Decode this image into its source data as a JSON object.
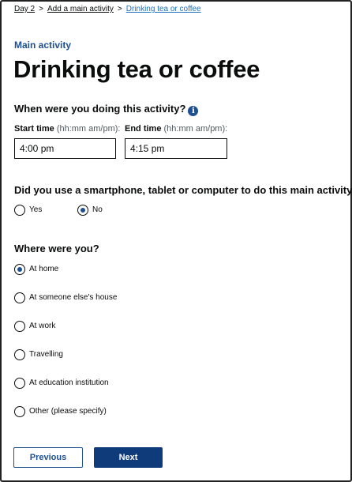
{
  "breadcrumb": {
    "items": [
      "Day 2",
      "Add a main activity",
      "Drinking tea or coffee"
    ],
    "separator": ">"
  },
  "caption": "Main activity",
  "title": "Drinking tea or coffee",
  "time_question": "When were you doing this activity?",
  "start_time": {
    "label": "Start time",
    "hint": "(hh:mm am/pm):",
    "value": "4:00 pm"
  },
  "end_time": {
    "label": "End time",
    "hint": "(hh:mm am/pm):",
    "value": "4:15 pm"
  },
  "device_question": "Did you use a smartphone, tablet or computer to do this main activity?",
  "device_options": [
    {
      "label": "Yes",
      "selected": false
    },
    {
      "label": "No",
      "selected": true
    }
  ],
  "location_question": "Where were you?",
  "location_options": [
    {
      "label": "At home",
      "selected": true
    },
    {
      "label": "At someone else's house",
      "selected": false
    },
    {
      "label": "At work",
      "selected": false
    },
    {
      "label": "Travelling",
      "selected": false
    },
    {
      "label": "At education institution",
      "selected": false
    },
    {
      "label": "Other (please specify)",
      "selected": false
    }
  ],
  "buttons": {
    "previous": "Previous",
    "next": "Next"
  },
  "colors": {
    "accent": "#1d4f91",
    "link": "#1d70b8",
    "primary_button": "#0f3b7a"
  },
  "icons": {
    "info": "info-icon"
  }
}
